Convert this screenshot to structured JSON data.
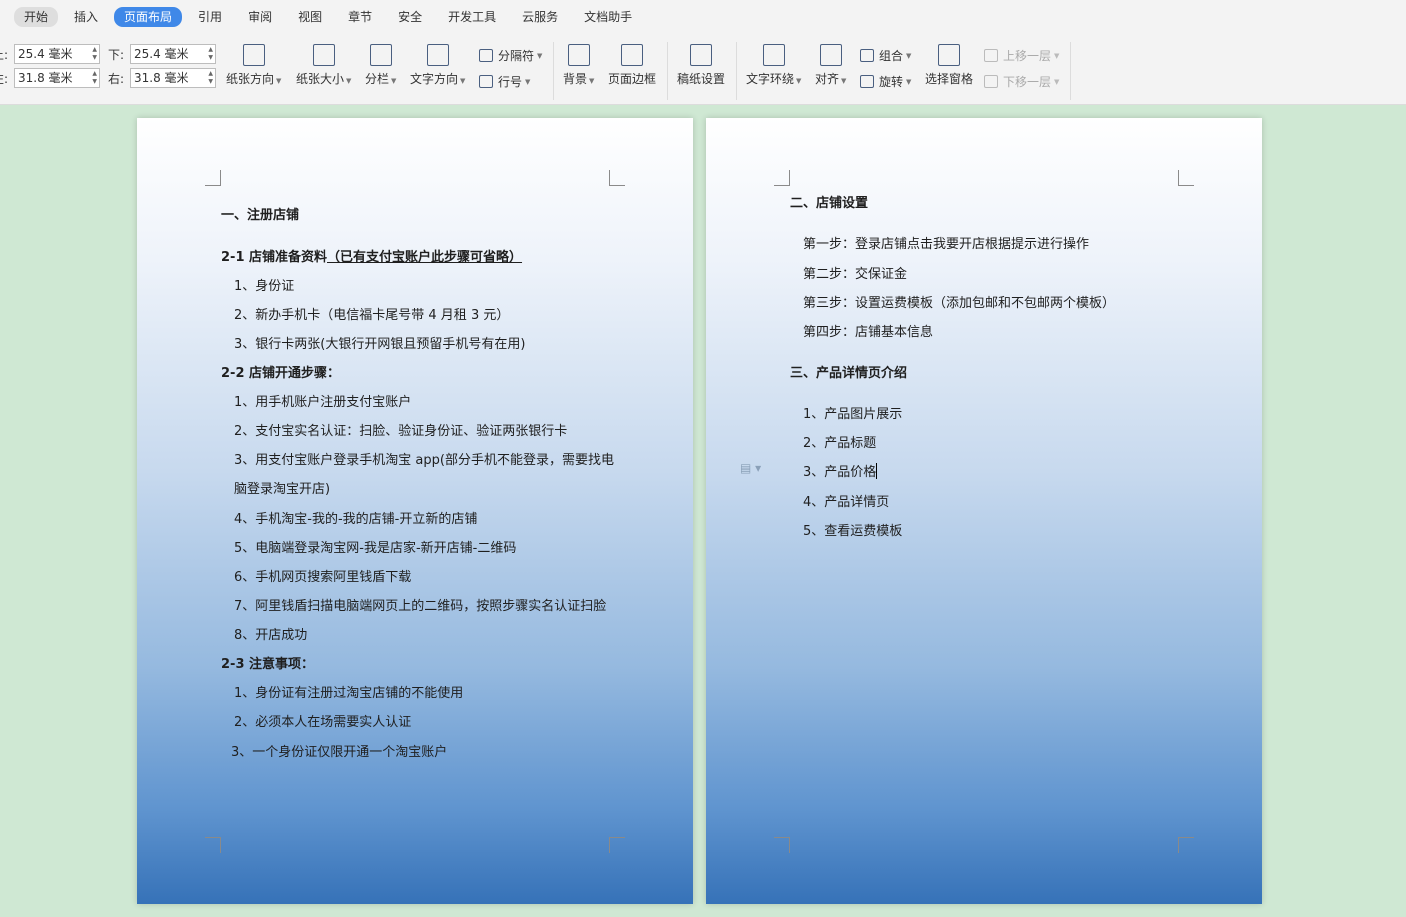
{
  "menu": {
    "tabs": [
      "开始",
      "插入",
      "页面布局",
      "引用",
      "审阅",
      "视图",
      "章节",
      "安全",
      "开发工具",
      "云服务",
      "文档助手"
    ],
    "active": "页面布局"
  },
  "ribbon": {
    "margins": {
      "top_label": "上:",
      "top_value": "25.4 毫米",
      "bottom_label": "下:",
      "bottom_value": "25.4 毫米",
      "left_label": "左:",
      "left_value": "31.8 毫米",
      "right_label": "右:",
      "right_value": "31.8 毫米"
    },
    "orientation": "纸张方向",
    "size": "纸张大小",
    "columns": "分栏",
    "text_direction": "文字方向",
    "breaks": "分隔符",
    "line_numbers": "行号",
    "background": "背景",
    "page_border": "页面边框",
    "paper_setup": "稿纸设置",
    "text_wrap": "文字环绕",
    "align": "对齐",
    "group": "组合",
    "rotate": "旋转",
    "selection_pane": "选择窗格",
    "bring_forward": "上移一层",
    "send_backward": "下移一层"
  },
  "page1": {
    "h1": "一、注册店铺",
    "s1_prefix": "2-1 店铺准备资料",
    "s1_underlined": "（已有支付宝账户此步骤可省略）",
    "s1_items": [
      "1、身份证",
      "2、新办手机卡（电信福卡尾号带 4 月租 3 元）",
      "3、银行卡两张(大银行开网银且预留手机号有在用)"
    ],
    "s2": "2-2 店铺开通步骤：",
    "s2_items": [
      "1、用手机账户注册支付宝账户",
      "2、支付宝实名认证：扫脸、验证身份证、验证两张银行卡",
      "3、用支付宝账户登录手机淘宝 app(部分手机不能登录，需要找电",
      "脑登录淘宝开店)",
      "4、手机淘宝-我的-我的店铺-开立新的店铺",
      "5、电脑端登录淘宝网-我是店家-新开店铺-二维码",
      "6、手机网页搜索阿里钱盾下载",
      "7、阿里钱盾扫描电脑端网页上的二维码，按照步骤实名认证扫脸",
      "8、开店成功"
    ],
    "s3": "2-3 注意事项：",
    "s3_items": [
      "1、身份证有注册过淘宝店铺的不能使用",
      "2、必须本人在场需要实人认证",
      "3、一个身份证仅限开通一个淘宝账户"
    ]
  },
  "page2": {
    "h2": "二、店铺设置",
    "steps": [
      "第一步：登录店铺点击我要开店根据提示进行操作",
      "第二步：交保证金",
      "第三步：设置运费模板（添加包邮和不包邮两个模板）",
      "第四步：店铺基本信息"
    ],
    "h3": "三、产品详情页介绍",
    "items": [
      "1、产品图片展示",
      "2、产品标题",
      "3、产品价格",
      "4、产品详情页",
      "5、查看运费模板"
    ]
  }
}
